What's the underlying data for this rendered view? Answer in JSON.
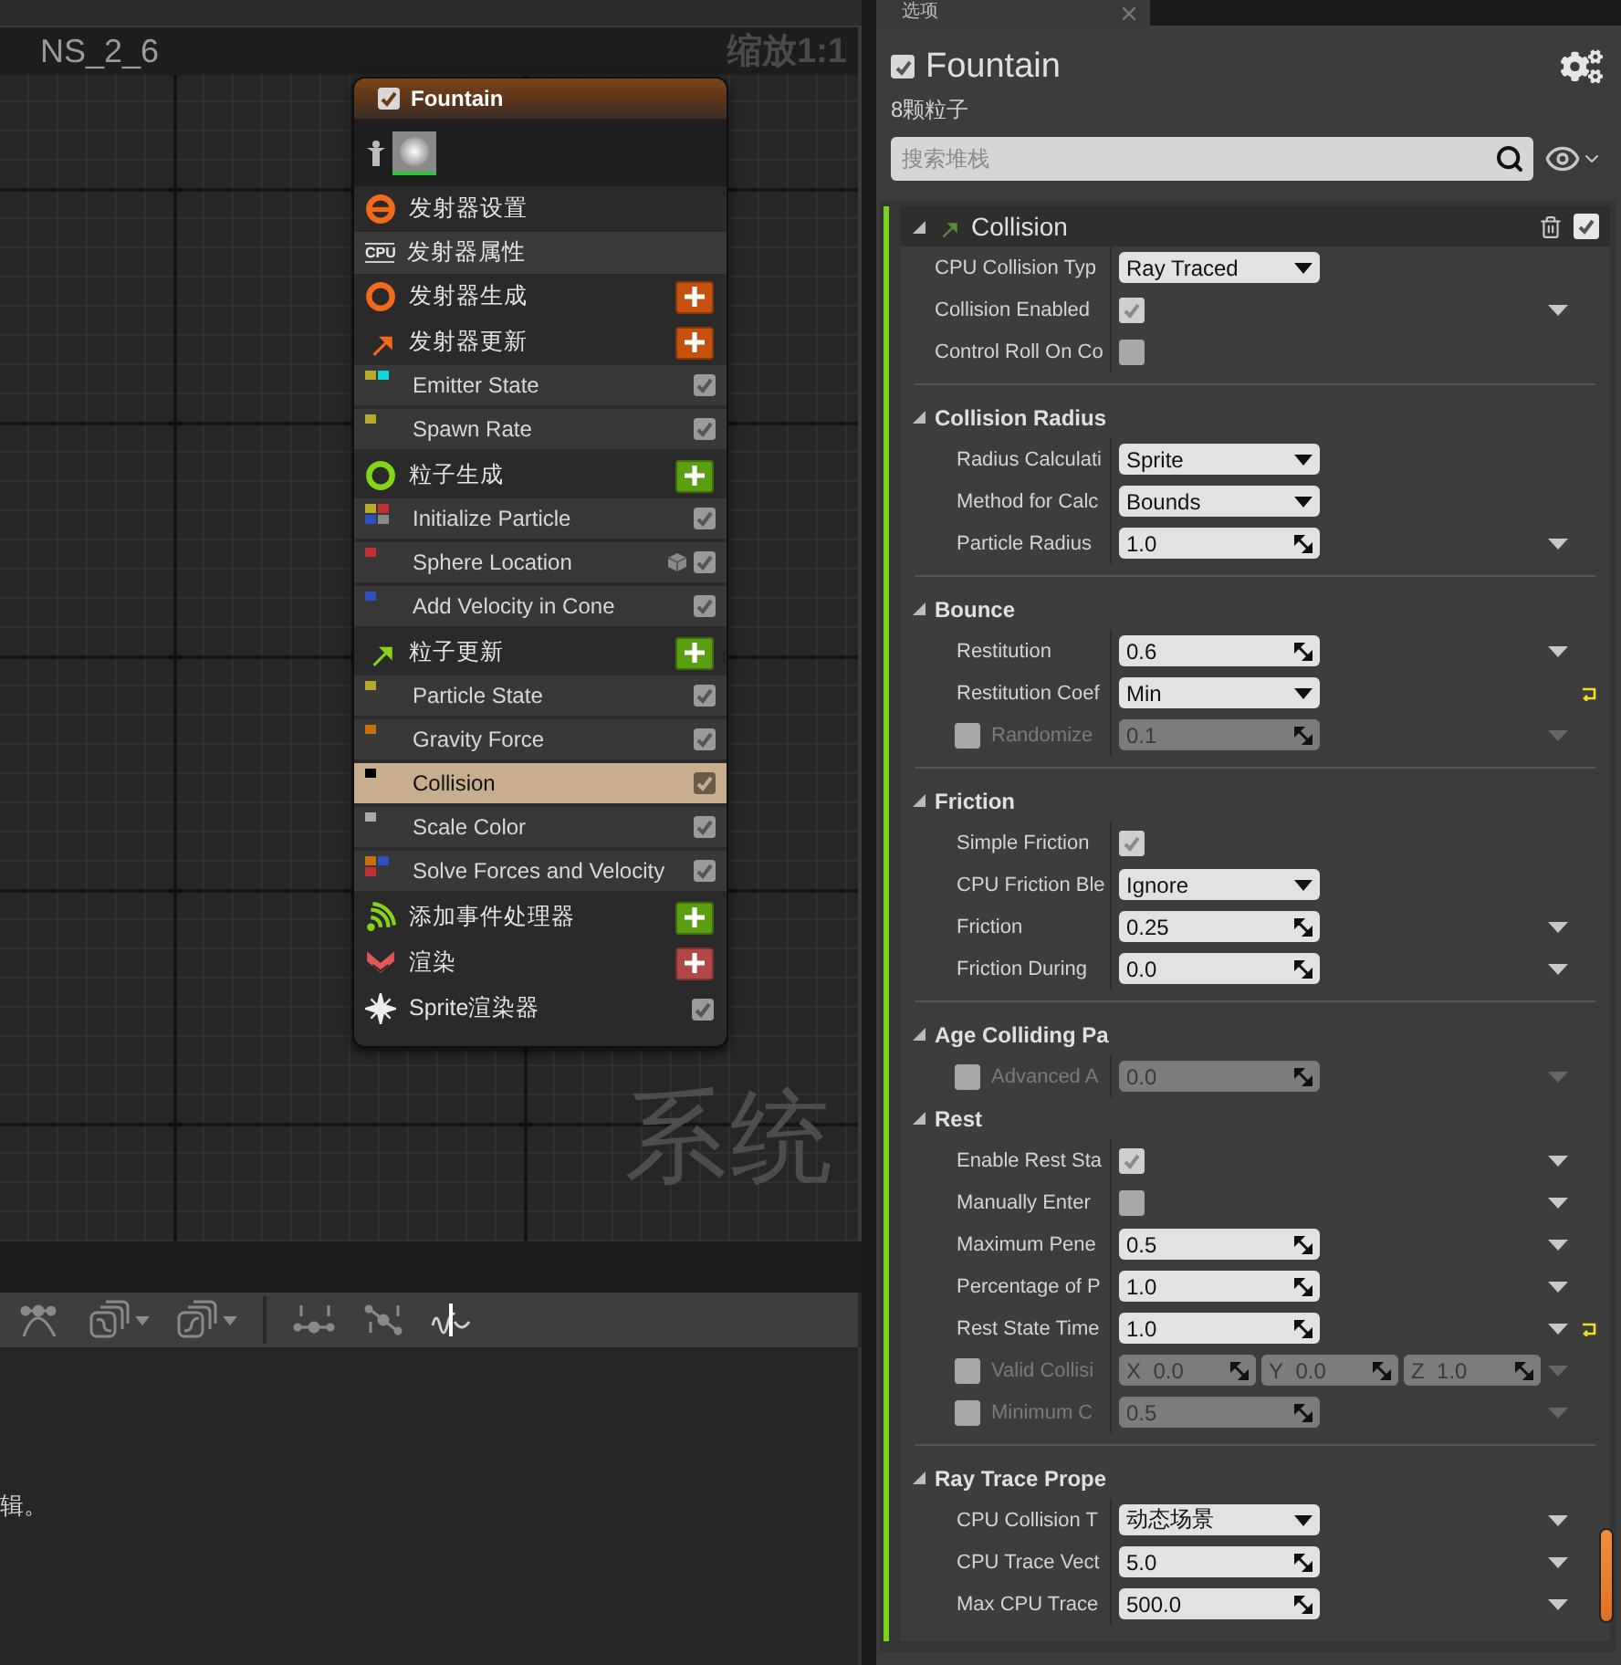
{
  "graph": {
    "title": "NS_2_6",
    "zoom": "缩放1:1",
    "corner_label": "系统",
    "node": {
      "title": "Fountain",
      "enabled": true,
      "items": [
        {
          "kind": "emitter_settings",
          "label": "发射器设置"
        },
        {
          "kind": "emitter_properties",
          "label": "发射器属性",
          "badge": "CPU"
        },
        {
          "kind": "emitter_spawn",
          "label": "发射器生成",
          "color": "#c4520e"
        },
        {
          "kind": "emitter_update",
          "label": "发射器更新",
          "color": "#c4520e"
        },
        {
          "kind": "module",
          "label": "Emitter State",
          "dots": [
            {
              "color": "#b8a830"
            },
            {
              "color": "#10d8d8"
            }
          ],
          "enabled": true,
          "selected": false
        },
        {
          "kind": "module",
          "label": "Spawn Rate",
          "dots": [
            {
              "color": "#b8a830"
            }
          ],
          "enabled": true,
          "selected": false
        },
        {
          "kind": "particle_spawn",
          "label": "粒子生成",
          "color": "#5a9e12"
        },
        {
          "kind": "module",
          "label": "Initialize Particle",
          "dots": [
            {
              "color": "#b8a830"
            },
            {
              "color": "#c03030"
            },
            {
              "color": "#3050c0"
            },
            {
              "color": "#888888"
            }
          ],
          "enabled": true,
          "selected": false
        },
        {
          "kind": "module",
          "label": "Sphere Location",
          "dots": [
            {
              "color": "#c03030"
            }
          ],
          "enabled": true,
          "selected": false,
          "cube_badge": true
        },
        {
          "kind": "module",
          "label": "Add Velocity in Cone",
          "dots": [
            {
              "color": "#3050c0"
            }
          ],
          "enabled": true,
          "selected": false
        },
        {
          "kind": "particle_update",
          "label": "粒子更新",
          "color": "#5a9e12"
        },
        {
          "kind": "module",
          "label": "Particle State",
          "dots": [
            {
              "color": "#b8a830"
            }
          ],
          "enabled": true,
          "selected": false
        },
        {
          "kind": "module",
          "label": "Gravity Force",
          "dots": [
            {
              "color": "#c87010"
            }
          ],
          "enabled": true,
          "selected": false
        },
        {
          "kind": "module",
          "label": "Collision",
          "dots": [
            {
              "color": "#000000"
            }
          ],
          "enabled": true,
          "selected": true
        },
        {
          "kind": "module",
          "label": "Scale Color",
          "dots": [
            {
              "color": "#aaaaaa"
            }
          ],
          "enabled": true,
          "selected": false
        },
        {
          "kind": "module",
          "label": "Solve Forces and Velocity",
          "dots": [
            {
              "color": "#c87010"
            },
            {
              "color": "#3050c0"
            },
            {
              "color": "#c03030"
            }
          ],
          "enabled": true,
          "selected": false
        },
        {
          "kind": "event_handler",
          "label": "添加事件处理器",
          "color": "#5a9e12"
        },
        {
          "kind": "render",
          "label": "渲染",
          "color": "#b04848"
        },
        {
          "kind": "renderer",
          "label": "Sprite渲染器",
          "enabled": true
        }
      ]
    }
  },
  "curve_editor": {
    "message": "辑。"
  },
  "panel": {
    "tab": "选项",
    "emitter": {
      "name": "Fountain",
      "enabled": true,
      "particle_count": "8颗粒子"
    },
    "search": {
      "placeholder": "搜索堆栈"
    },
    "stack": {
      "module": {
        "title": "Collision",
        "enabled": true
      },
      "sections": [
        {
          "divider": false,
          "rows": [
            {
              "label": "CPU Collision Typ",
              "kind": "dropdown",
              "value": "Ray Traced",
              "disabled": false,
              "caret": false,
              "reset": false
            },
            {
              "label": "Collision Enabled",
              "kind": "checkbox",
              "checked": true,
              "disabled": false,
              "caret": true,
              "reset": false
            },
            {
              "label": "Control Roll On Co",
              "kind": "checkbox",
              "checked": false,
              "disabled": false,
              "caret": false,
              "reset": false
            }
          ]
        },
        {
          "title": "Collision Radius",
          "divider": true,
          "rows": [
            {
              "label": "Radius Calculati",
              "kind": "dropdown",
              "value": "Sprite",
              "disabled": false,
              "caret": false,
              "reset": false
            },
            {
              "label": "Method for Calc",
              "kind": "dropdown",
              "value": "Bounds",
              "disabled": false,
              "caret": false,
              "reset": false
            },
            {
              "label": "Particle Radius",
              "kind": "number",
              "value": "1.0",
              "disabled": false,
              "caret": true,
              "reset": false
            }
          ]
        },
        {
          "title": "Bounce",
          "divider": true,
          "rows": [
            {
              "label": "Restitution",
              "kind": "number",
              "value": "0.6",
              "disabled": false,
              "caret": true,
              "reset": false
            },
            {
              "label": "Restitution Coef",
              "kind": "dropdown",
              "value": "Min",
              "disabled": false,
              "caret": false,
              "reset": true
            },
            {
              "label": "Randomize",
              "kind": "number",
              "value": "0.1",
              "disabled": true,
              "toggle": false,
              "caret": true,
              "reset": false
            }
          ]
        },
        {
          "title": "Friction",
          "divider": true,
          "rows": [
            {
              "label": "Simple Friction",
              "kind": "checkbox",
              "checked": true,
              "disabled": false,
              "caret": false,
              "reset": false
            },
            {
              "label": "CPU Friction Ble",
              "kind": "dropdown",
              "value": "Ignore",
              "disabled": false,
              "caret": false,
              "reset": false
            },
            {
              "label": "Friction",
              "kind": "number",
              "value": "0.25",
              "disabled": false,
              "caret": true,
              "reset": false
            },
            {
              "label": "Friction During",
              "kind": "number",
              "value": "0.0",
              "disabled": false,
              "caret": true,
              "reset": false
            }
          ]
        },
        {
          "title": "Age Colliding Pa",
          "divider": true,
          "rows": [
            {
              "label": "Advanced A",
              "kind": "number",
              "value": "0.0",
              "disabled": true,
              "toggle": false,
              "caret": true,
              "reset": false
            }
          ]
        },
        {
          "title": "Rest",
          "divider": false,
          "rows": [
            {
              "label": "Enable Rest Sta",
              "kind": "checkbox",
              "checked": true,
              "disabled": false,
              "caret": true,
              "reset": false
            },
            {
              "label": "Manually Enter",
              "kind": "checkbox",
              "checked": false,
              "disabled": false,
              "caret": true,
              "reset": false
            },
            {
              "label": "Maximum Pene",
              "kind": "number",
              "value": "0.5",
              "disabled": false,
              "caret": true,
              "reset": false
            },
            {
              "label": "Percentage of P",
              "kind": "number",
              "value": "1.0",
              "disabled": false,
              "caret": true,
              "reset": false
            },
            {
              "label": "Rest State Time",
              "kind": "number",
              "value": "1.0",
              "disabled": false,
              "caret": true,
              "reset": true
            },
            {
              "label": "Valid Collisi",
              "kind": "vector",
              "values": [
                {
                  "axis": "X",
                  "value": "0.0"
                },
                {
                  "axis": "Y",
                  "value": "0.0"
                },
                {
                  "axis": "Z",
                  "value": "1.0"
                }
              ],
              "disabled": true,
              "toggle": false,
              "caret": true,
              "reset": false
            },
            {
              "label": "Minimum C",
              "kind": "number",
              "value": "0.5",
              "disabled": true,
              "toggle": false,
              "caret": true,
              "reset": false
            }
          ]
        },
        {
          "title": "Ray Trace Prope",
          "divider": true,
          "rows": [
            {
              "label": "CPU Collision T",
              "kind": "dropdown",
              "value": "动态场景",
              "disabled": false,
              "caret": true,
              "reset": false
            },
            {
              "label": "CPU Trace Vect",
              "kind": "number",
              "value": "5.0",
              "disabled": false,
              "caret": true,
              "reset": false
            },
            {
              "label": "Max CPU Trace",
              "kind": "number",
              "value": "500.0",
              "disabled": false,
              "caret": true,
              "reset": false
            }
          ]
        }
      ]
    }
  }
}
